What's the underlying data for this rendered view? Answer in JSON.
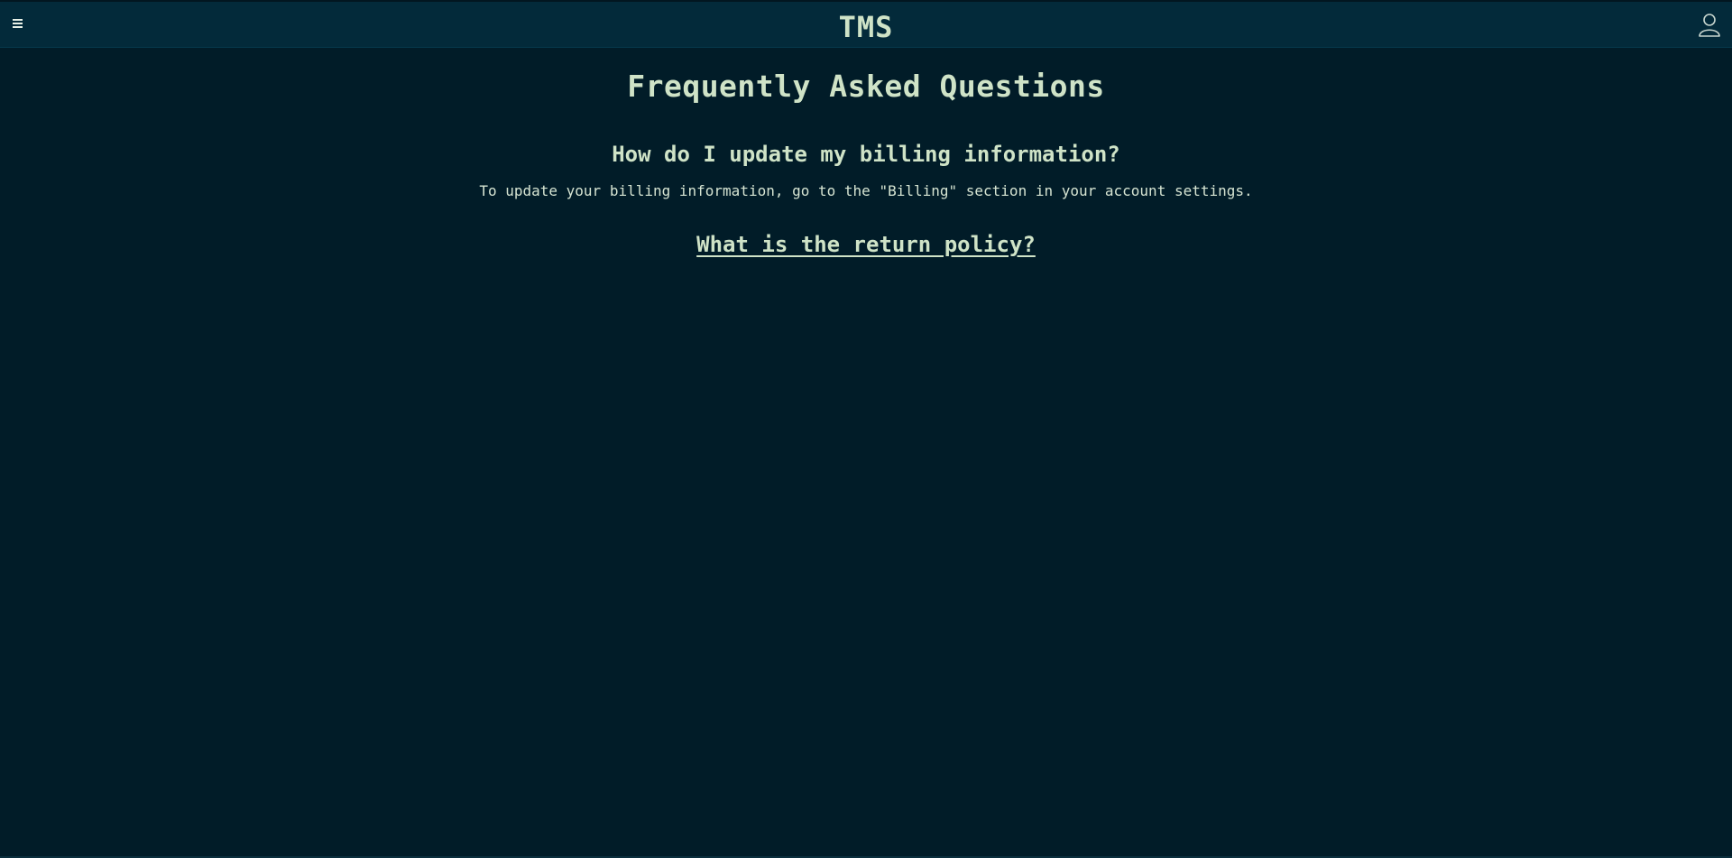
{
  "header": {
    "title": "TMS",
    "menu_icon": "hamburger-menu-icon",
    "user_icon": "user-icon"
  },
  "main": {
    "heading": "Frequently Asked Questions",
    "faqs": [
      {
        "question": "How do I update my billing information?",
        "answer": "To update your billing information, go to the \"Billing\" section in your account settings.",
        "expanded": true
      },
      {
        "question": "What is the return policy?",
        "answer": "",
        "expanded": false
      }
    ]
  },
  "colors": {
    "background": "#011c28",
    "header_background": "#032a3a",
    "text": "#cfe3c7"
  }
}
